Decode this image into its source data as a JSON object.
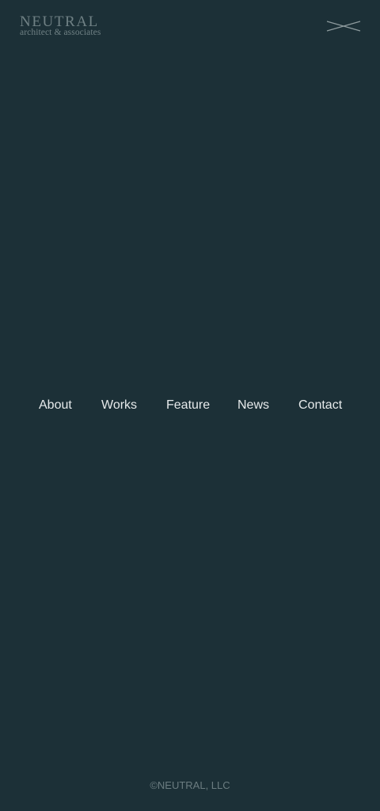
{
  "header": {
    "logo_main": "NEUTRAL",
    "logo_sub": "architect & associates",
    "close_icon": "close-x-icon"
  },
  "nav": {
    "items": [
      {
        "label": "About"
      },
      {
        "label": "Works"
      },
      {
        "label": "Feature"
      },
      {
        "label": "News"
      },
      {
        "label": "Contact"
      }
    ]
  },
  "footer": {
    "copyright": "©NEUTRAL, LLC"
  },
  "colors": {
    "background": "#1c3037",
    "nav_text": "#e6eaeb",
    "muted_text": "#6f8084"
  }
}
